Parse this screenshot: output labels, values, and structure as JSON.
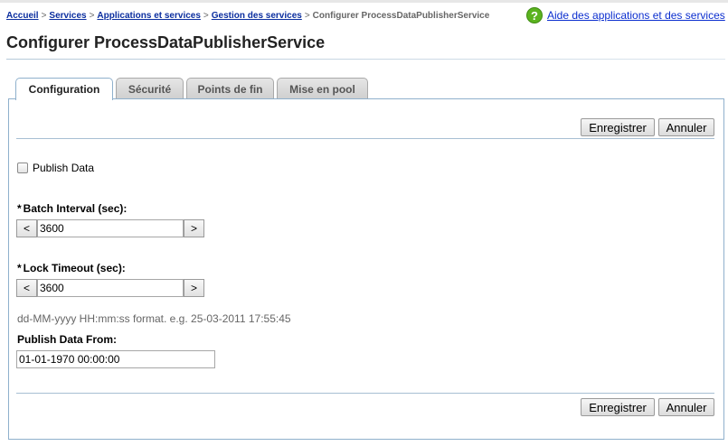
{
  "breadcrumb": {
    "items": [
      "Accueil",
      "Services",
      "Applications et services",
      "Gestion des services"
    ],
    "current": "Configurer ProcessDataPublisherService",
    "separator": ">"
  },
  "help": {
    "icon": "help-icon",
    "icon_glyph": "?",
    "label": "Aide des applications et des services"
  },
  "page": {
    "title": "Configurer ProcessDataPublisherService"
  },
  "tabs": [
    {
      "label": "Configuration",
      "active": true
    },
    {
      "label": "Sécurité",
      "active": false
    },
    {
      "label": "Points de fin",
      "active": false
    },
    {
      "label": "Mise en pool",
      "active": false
    }
  ],
  "actions": {
    "save_label": "Enregistrer",
    "cancel_label": "Annuler"
  },
  "form": {
    "publish_data": {
      "label": "Publish Data",
      "checked": false
    },
    "batch_interval": {
      "required_mark": "*",
      "label": "Batch Interval (sec):",
      "value": "3600",
      "dec_label": "<",
      "inc_label": ">"
    },
    "lock_timeout": {
      "required_mark": "*",
      "label": "Lock Timeout (sec):",
      "value": "3600",
      "dec_label": "<",
      "inc_label": ">"
    },
    "date_hint": "dd-MM-yyyy HH:mm:ss format. e.g. 25-03-2011 17:55:45",
    "publish_data_from": {
      "label": "Publish Data From:",
      "value": "01-01-1970 00:00:00"
    }
  },
  "colors": {
    "link": "#0b2e9f",
    "accent_border": "#8fb0cc",
    "help_green": "#5bb31f"
  }
}
